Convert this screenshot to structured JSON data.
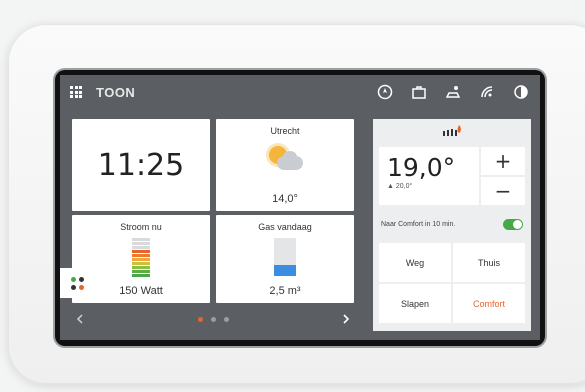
{
  "brand": "TOON",
  "topbar": {
    "icons": [
      "grid-icon",
      "compass-icon",
      "toolbox-icon",
      "solar-icon",
      "wifi-icon",
      "contrast-icon"
    ]
  },
  "tiles": {
    "clock": {
      "time": "11:25"
    },
    "weather": {
      "title": "Utrecht",
      "temperature": "14,0°",
      "icon": "partly-cloudy-icon"
    },
    "power": {
      "title": "Stroom nu",
      "value": "150 Watt",
      "level": 0.3
    },
    "gas": {
      "title": "Gas vandaag",
      "value": "2,5 m³",
      "level": 0.3
    }
  },
  "thermostat": {
    "setpoint": "19,0°",
    "current": "▲ 20,0°",
    "plus": "+",
    "minus": "−",
    "program_text": "Naar Comfort in 10 min.",
    "program_enabled": true,
    "modes": [
      "Weg",
      "Thuis",
      "Slapen",
      "Comfort"
    ],
    "active_mode": "Comfort"
  },
  "pager": {
    "pages": 3,
    "active": 0
  },
  "colors": {
    "accent": "#e9632c",
    "toggle": "#46a84a",
    "gas": "#3a8de0",
    "sun": "#f4b63a"
  }
}
